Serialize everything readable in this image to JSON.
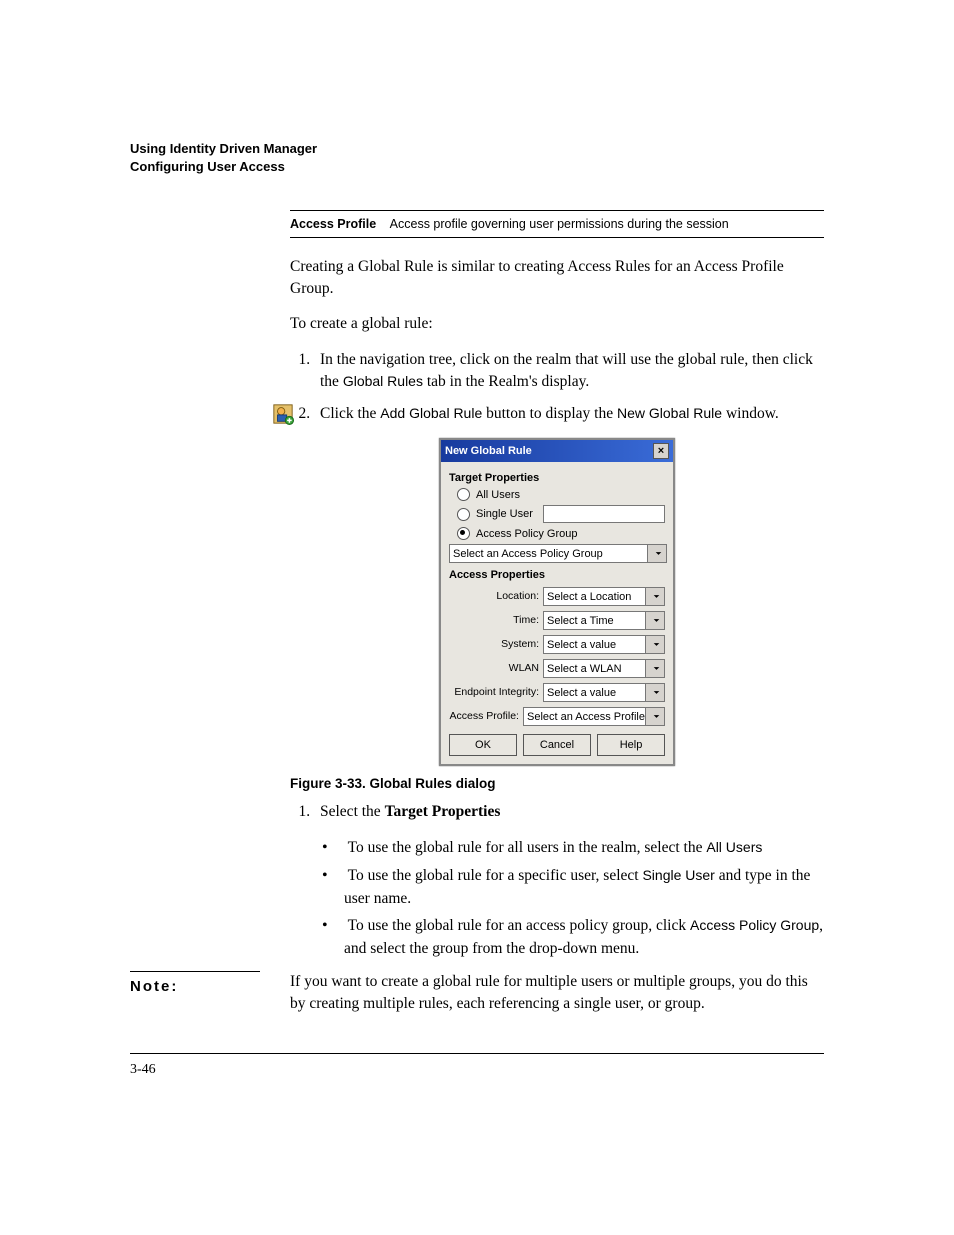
{
  "header": {
    "line1": "Using Identity Driven Manager",
    "line2": "Configuring User Access"
  },
  "defTable": {
    "term": "Access Profile",
    "desc": "Access profile governing user permissions during the session"
  },
  "para1": "Creating a Global Rule is similar to creating Access Rules for an Access Profile Group.",
  "para2": "To create a global rule:",
  "step1_a": "In the navigation tree, click on the realm that will use the global rule, then click the ",
  "step1_tab": "Global Rules",
  "step1_b": " tab in the Realm's display.",
  "step2_a": "Click the ",
  "step2_btn": "Add Global Rule",
  "step2_b": " button to display the ",
  "step2_win": "New Global Rule",
  "step2_c": " window.",
  "dialog": {
    "title": "New Global Rule",
    "sect1": "Target Properties",
    "radio_all": "All Users",
    "radio_single": "Single User",
    "radio_apg": "Access Policy Group",
    "apg_placeholder": "Select an Access Policy Group",
    "sect2": "Access Properties",
    "rows": [
      {
        "label": "Location:",
        "value": "Select a Location"
      },
      {
        "label": "Time:",
        "value": "Select a Time"
      },
      {
        "label": "System:",
        "value": "Select a value"
      },
      {
        "label": "WLAN",
        "value": "Select a WLAN"
      },
      {
        "label": "Endpoint Integrity:",
        "value": "Select a value"
      },
      {
        "label": "Access Profile:",
        "value": "Select an Access Profile"
      }
    ],
    "buttons": {
      "ok": "OK",
      "cancel": "Cancel",
      "help": "Help"
    }
  },
  "figCaption": "Figure 3-33. Global Rules dialog",
  "step_post_1a": "Select the ",
  "step_post_1b": "Target Properties",
  "bullet1_a": "To use the global rule for all users in the realm, select the ",
  "bullet1_b": "All Users",
  "bullet2_a": "To use the global rule for a specific user, select ",
  "bullet2_b": "Single User",
  "bullet2_c": " and type in the user name.",
  "bullet3_a": "To use the global rule for an access policy group, click ",
  "bullet3_b": "Access Policy Group",
  "bullet3_c": ", and select the group from the drop-down menu.",
  "noteLabel": "Note:",
  "noteText": "If you want to create a global rule for multiple users or multiple groups, you do this by creating multiple rules, each referencing a single user, or group.",
  "pageNum": "3-46"
}
